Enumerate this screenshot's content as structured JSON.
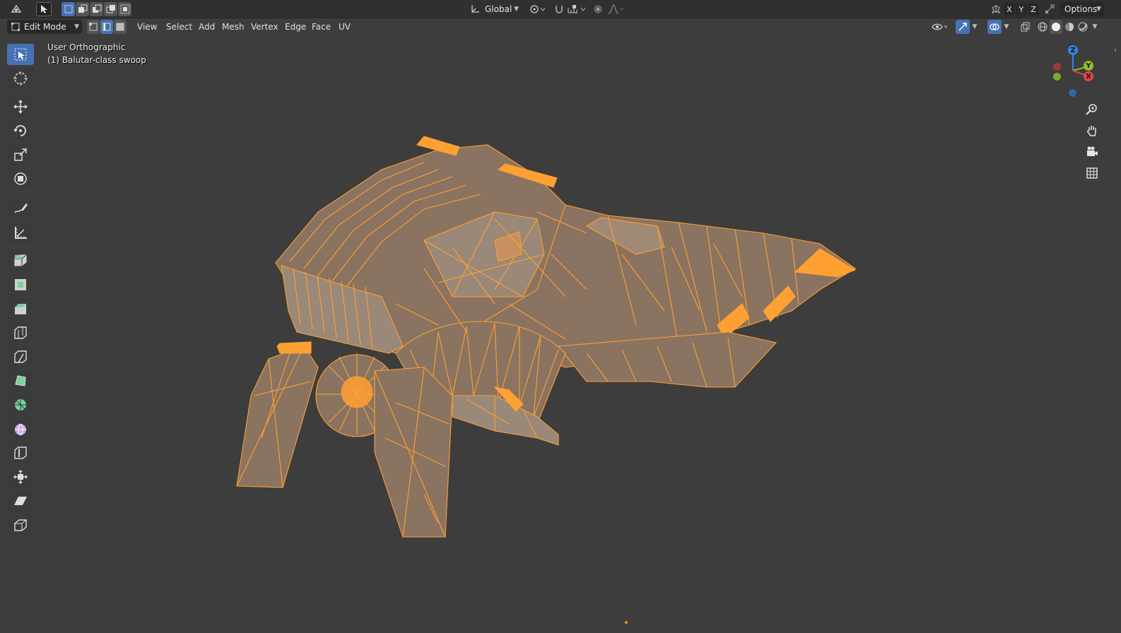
{
  "toolbar_top": {
    "orientation_label": "Global",
    "axis_x": "X",
    "axis_y": "Y",
    "axis_z": "Z",
    "options_label": "Options"
  },
  "header": {
    "mode_label": "Edit Mode",
    "menus": [
      "View",
      "Select",
      "Add",
      "Mesh",
      "Vertex",
      "Edge",
      "Face",
      "UV"
    ]
  },
  "viewport": {
    "view_name": "User Orthographic",
    "object_label": "(1) Balutar-class swoop"
  },
  "gizmo": {
    "z_label": "Z",
    "y_label": "Y",
    "x_label": "X"
  },
  "colors": {
    "background": "#3d3d3d",
    "header": "#303030",
    "accent": "#4772b3",
    "selection": "#ffa033",
    "axis_x": "#e8414b",
    "axis_y": "#8ac422",
    "axis_z": "#2f86e8"
  },
  "icons": {
    "select_tool": "select-box-icon",
    "cursor_tool": "cursor-icon",
    "move_tool": "move-icon",
    "rotate_tool": "rotate-icon",
    "scale_tool": "scale-icon",
    "transform_tool": "transform-icon",
    "annotate_tool": "annotate-icon",
    "measure_tool": "measure-icon",
    "extrude_tool": "extrude-icon",
    "inset_tool": "inset-icon",
    "bevel_tool": "bevel-icon",
    "loopcut_tool": "loop-cut-icon",
    "knife_tool": "knife-icon",
    "polybuild_tool": "poly-build-icon",
    "spin_tool": "spin-icon",
    "smooth_tool": "smooth-icon",
    "edge_slide_tool": "edge-slide-icon",
    "shrink_tool": "shrink-fatten-icon",
    "shear_tool": "shear-icon",
    "rip_tool": "rip-region-icon"
  }
}
